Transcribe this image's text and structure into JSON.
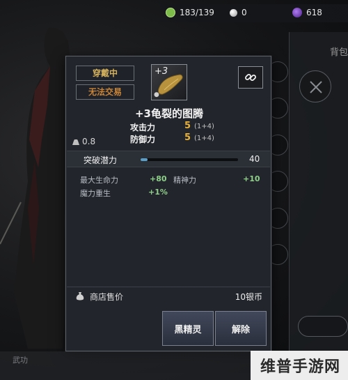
{
  "currency": {
    "energy": "183/139",
    "pearls": "0",
    "crystals": "618"
  },
  "right_panel": {
    "tab_label": "背包"
  },
  "item": {
    "tag_equipped": "穿戴中",
    "tag_untradable": "无法交易",
    "enhance_badge": "+3",
    "name": "+3龟裂的图腾",
    "stats": [
      {
        "label": "攻击力",
        "value": "5",
        "detail": "(1+4)"
      },
      {
        "label": "防御力",
        "value": "5",
        "detail": "(1+4)"
      }
    ],
    "weight": "0.8",
    "potential": {
      "label": "突破潜力",
      "value": "40",
      "fill_fraction": 0.07
    },
    "attributes": [
      {
        "label": "最大生命力",
        "value": "+80"
      },
      {
        "label": "精神力",
        "value": "+10"
      },
      {
        "label": "魔力重生",
        "value": "+1%"
      }
    ],
    "sell_label": "商店售价",
    "sell_value": "10银币"
  },
  "buttons": {
    "black_spirit": "黑精灵",
    "unequip": "解除"
  },
  "bottom": {
    "left_text": "武功"
  },
  "watermark": "维普手游网",
  "icons": {
    "energy": "energy-icon",
    "pearl": "pearl-icon",
    "crystal": "crystal-icon",
    "link": "link-icon",
    "weight": "weight-icon",
    "sell": "money-bag-icon"
  },
  "colors": {
    "stat_value": "#e8b23a",
    "attr_value": "#8fd08a",
    "tag_equipped": "#d4b15e",
    "tag_untradable": "#c9853a",
    "potential_fill": "#5a9fc7"
  }
}
